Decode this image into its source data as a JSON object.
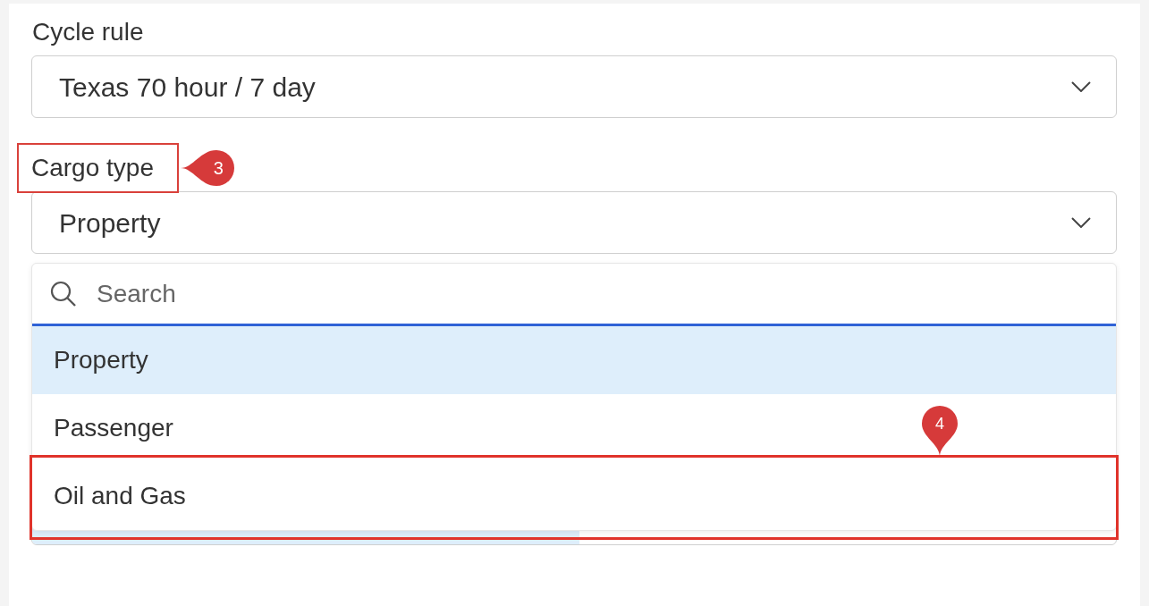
{
  "fields": [
    {
      "label": "Cycle rule",
      "value": "Texas 70 hour / 7 day"
    },
    {
      "label": "Cargo type",
      "value": "Property",
      "annotation": "3",
      "dropdown": {
        "search": {
          "placeholder": "Search"
        },
        "options": [
          {
            "label": "Property",
            "selected": true
          },
          {
            "label": "Passenger",
            "selected": false
          },
          {
            "label": "Oil and Gas",
            "selected": false,
            "annotation": "4"
          }
        ]
      }
    }
  ]
}
